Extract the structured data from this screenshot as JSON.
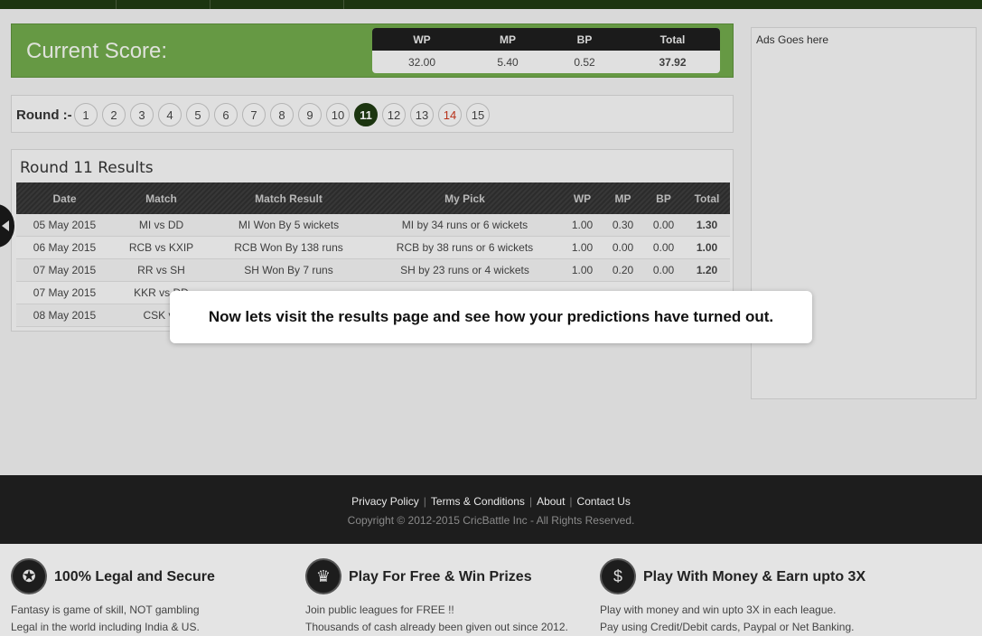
{
  "score": {
    "title": "Current Score:",
    "headers": [
      "WP",
      "MP",
      "BP",
      "Total"
    ],
    "values": [
      "32.00",
      "5.40",
      "0.52",
      "37.92"
    ]
  },
  "rounds": {
    "label": "Round :-",
    "items": [
      "1",
      "2",
      "3",
      "4",
      "5",
      "6",
      "7",
      "8",
      "9",
      "10",
      "11",
      "12",
      "13",
      "14",
      "15"
    ],
    "active": "11",
    "highlighted": "14"
  },
  "results": {
    "title": "Round 11 Results",
    "columns": [
      "Date",
      "Match",
      "Match Result",
      "My Pick",
      "WP",
      "MP",
      "BP",
      "Total"
    ],
    "rows": [
      [
        "05 May 2015",
        "MI vs DD",
        "MI Won By 5 wickets",
        "MI by 34 runs or 6 wickets",
        "1.00",
        "0.30",
        "0.00",
        "1.30"
      ],
      [
        "06 May 2015",
        "RCB vs KXIP",
        "RCB Won By 138 runs",
        "RCB by 38 runs or 6 wickets",
        "1.00",
        "0.00",
        "0.00",
        "1.00"
      ],
      [
        "07 May 2015",
        "RR vs SH",
        "SH Won By 7 runs",
        "SH by 23 runs or 4 wickets",
        "1.00",
        "0.20",
        "0.00",
        "1.20"
      ],
      [
        "07 May 2015",
        "KKR vs DD",
        "",
        "",
        "",
        "",
        "",
        ""
      ],
      [
        "08 May 2015",
        "CSK vs",
        "",
        "",
        "",
        "",
        "",
        ""
      ]
    ]
  },
  "ads": {
    "text": "Ads Goes here"
  },
  "tooltip": {
    "text": "Now lets visit the results page and see how your predictions have turned out."
  },
  "footer": {
    "links": [
      "Privacy Policy",
      "Terms & Conditions",
      "About",
      "Contact Us"
    ],
    "copyright": "Copyright © 2012-2015 CricBattle Inc - All Rights Reserved."
  },
  "features": [
    {
      "icon": "award-icon",
      "title": "100% Legal and Secure",
      "line1": "Fantasy is game of skill, NOT gambling",
      "line2": "Legal in the world including India & US."
    },
    {
      "icon": "trophy-icon",
      "title": "Play For Free & Win Prizes",
      "line1": "Join public leagues for FREE !!",
      "line2": "Thousands of cash already been given out since 2012."
    },
    {
      "icon": "money-bag-icon",
      "title": "Play With Money & Earn upto 3X",
      "line1": "Play with money and win upto 3X in each league.",
      "line2": "Pay using Credit/Debit cards, Paypal or Net Banking."
    }
  ],
  "colors": {
    "brand_green": "#6fa64a",
    "dark_green": "#1f3a12",
    "highlight_round": "#c8361c",
    "footer_bg": "#1d1d1d"
  }
}
